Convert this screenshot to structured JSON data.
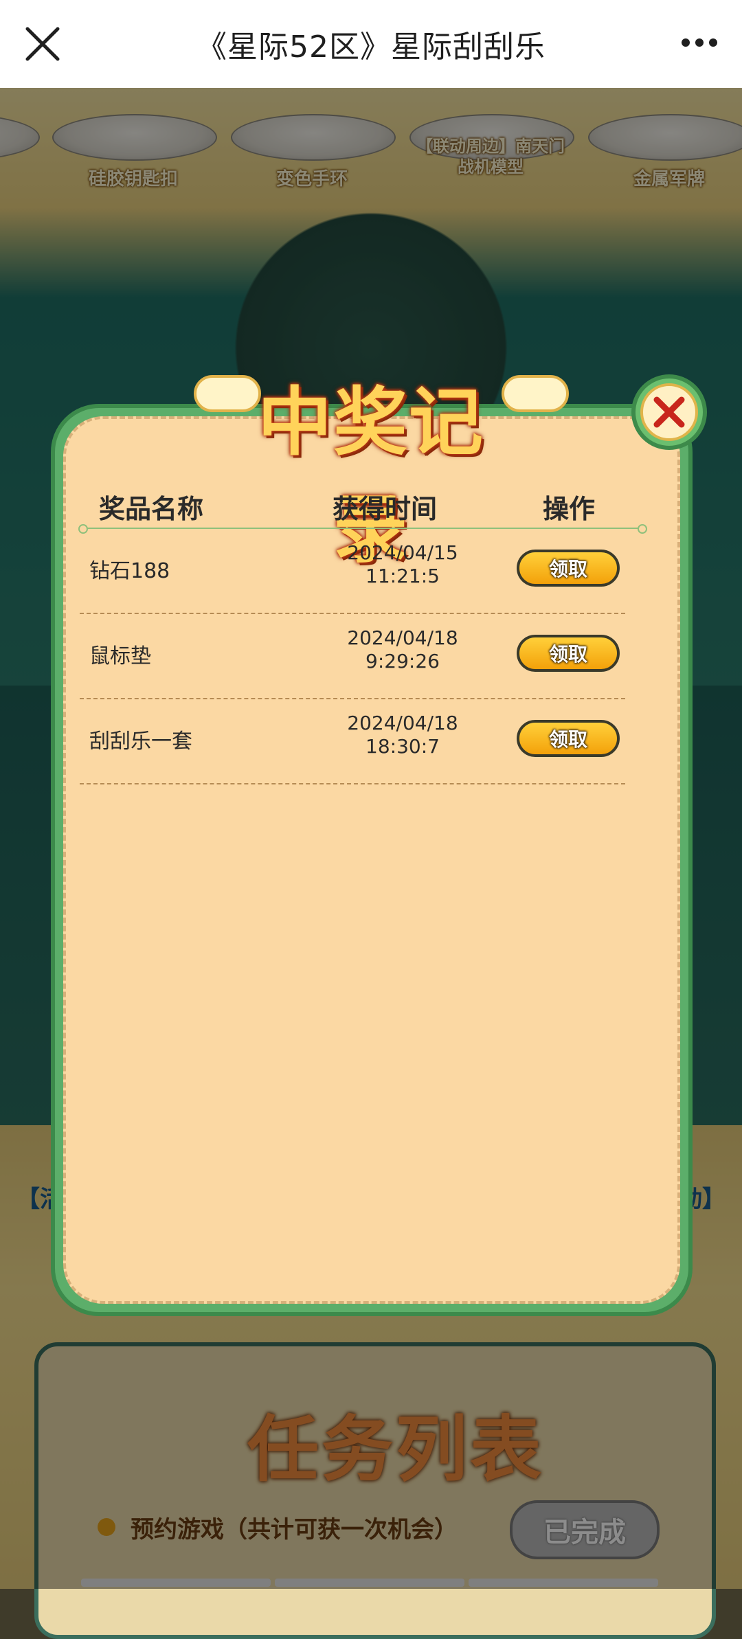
{
  "topbar": {
    "title": "《星际52区》星际刮刮乐",
    "close_icon": "close-icon",
    "more_icon": "more-icon"
  },
  "background": {
    "prizes": [
      "硅胶钥匙扣",
      "变色手环",
      "【联动周边】南天门战机模型",
      "金属军牌"
    ],
    "side_left": "【活",
    "side_right": "动】",
    "task_panel": {
      "title": "任务列表",
      "task": "预约游戏（共计可获一次机会）",
      "button": "已完成"
    }
  },
  "modal": {
    "title": "中奖记录",
    "headers": {
      "name": "奖品名称",
      "time": "获得时间",
      "action": "操作"
    },
    "rows": [
      {
        "name": "钻石188",
        "date": "2024/04/15",
        "time": "11:21:5",
        "action": "领取"
      },
      {
        "name": "鼠标垫",
        "date": "2024/04/18",
        "time": "9:29:26",
        "action": "领取"
      },
      {
        "name": "刮刮乐一套",
        "date": "2024/04/18",
        "time": "18:30:7",
        "action": "领取"
      }
    ]
  },
  "colors": {
    "modal_frame": "#5cae6a",
    "modal_fill": "#fbd8a3",
    "claim_button": "#f3a10a",
    "close_red": "#c8261c"
  }
}
